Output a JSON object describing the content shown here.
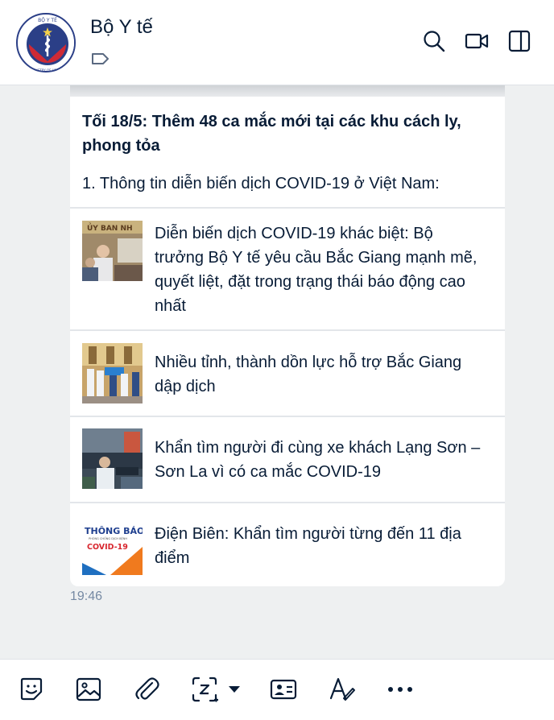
{
  "header": {
    "contact_name": "Bộ Y tế",
    "avatar_text_top": "BỘ Y TẾ",
    "avatar_text_bottom": "MINISTRY OF HEALTH",
    "icons": [
      "search-icon",
      "video-call-icon",
      "side-panel-icon"
    ]
  },
  "message": {
    "title": "Tối 18/5: Thêm 48 ca mắc mới tại các khu cách ly, phong tỏa",
    "subtitle": "1. Thông tin diễn biến dịch COVID-19 ở Việt Nam:",
    "items": [
      {
        "text": "Diễn biến dịch COVID-19 khác biệt: Bộ trưởng Bộ Y tế yêu cầu Bắc Giang mạnh mẽ, quyết liệt, đặt trong trạng thái báo động cao nhất",
        "thumb_label": "ỦY BAN NH"
      },
      {
        "text": "Nhiều tỉnh, thành dồn lực hỗ trợ Bắc Giang dập dịch"
      },
      {
        "text": "Khẩn tìm người đi cùng xe khách Lạng Sơn – Sơn La vì có ca mắc COVID-19"
      },
      {
        "text": "Điện Biên: Khẩn tìm người từng đến 11 địa điểm",
        "thumb_label_1": "THÔNG BÁO",
        "thumb_label_2": "PHÒNG CHỐNG DỊCH BỆNH",
        "thumb_label_3": "COVID-19"
      }
    ],
    "time": "19:46"
  },
  "toolbar": {
    "icons": [
      "sticker-icon",
      "image-icon",
      "attachment-icon",
      "screenshot-icon",
      "contact-card-icon",
      "text-format-icon",
      "more-icon"
    ]
  },
  "colors": {
    "text": "#081c36",
    "muted": "#7589a3",
    "background": "#eef0f1",
    "icon": "#081c36"
  }
}
